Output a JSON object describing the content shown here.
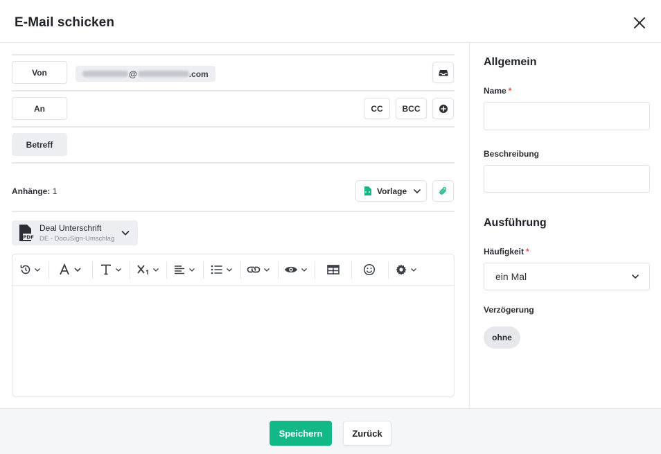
{
  "header": {
    "title": "E-Mail schicken"
  },
  "compose": {
    "from_label": "Von",
    "from_domain": "@",
    "from_tld": ".com",
    "to_label": "An",
    "cc_label": "CC",
    "bcc_label": "BCC",
    "subject_label": "Betreff",
    "attachments_label": "Anhänge:",
    "attachments_count": "1",
    "template_label": "Vorlage",
    "attachment": {
      "name": "Deal Unterschrift",
      "subtitle": "DE - DocuSign-Umschlag",
      "file_type": "PDF"
    },
    "toolbar_icons": [
      "history-icon",
      "font-color-icon",
      "text-style-icon",
      "subscript-icon",
      "align-left-icon",
      "list-icon",
      "link-icon",
      "preview-icon",
      "table-icon",
      "emoji-icon",
      "settings-icon"
    ]
  },
  "sidebar": {
    "general_title": "Allgemein",
    "name_label": "Name",
    "description_label": "Beschreibung",
    "execution_title": "Ausführung",
    "frequency_label": "Häufigkeit",
    "frequency_value": "ein Mal",
    "delay_label": "Verzögerung",
    "delay_value": "ohne",
    "required_mark": "*"
  },
  "footer": {
    "save_label": "Speichern",
    "back_label": "Zurück"
  },
  "colors": {
    "accent": "#12b886",
    "required": "#e5484d",
    "chip_bg": "#eceef1"
  }
}
